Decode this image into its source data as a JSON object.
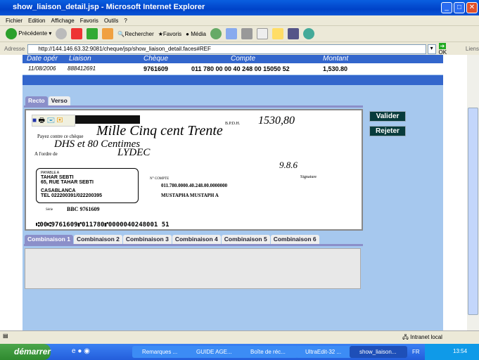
{
  "window": {
    "title": "show_liaison_detail.jsp - Microsoft Internet Explorer"
  },
  "menu": [
    "Fichier",
    "Edition",
    "Affichage",
    "Favoris",
    "Outils",
    "?"
  ],
  "toolbar": {
    "back": "Précédente",
    "search": "Rechercher",
    "favorites": "Favoris",
    "media": "Média"
  },
  "address": {
    "label": "Adresse",
    "url": "http://144.146.63.32:9081/cheque/jsp/show_liaison_detail.faces#REF",
    "go": "OK",
    "links": "Liens"
  },
  "table": {
    "headers": [
      "Date opér",
      "Liaison",
      "Chèque",
      "Compte",
      "Montant"
    ],
    "row": [
      "11/08/2006",
      "888412691",
      "9761609",
      "011 780 00 00 40 248 00 15050 52",
      "1,530.80"
    ]
  },
  "image_tabs": [
    "Recto",
    "Verso"
  ],
  "check": {
    "amount_label": "B.P.D.H.",
    "amount": "1530,80",
    "pay_label": "Payez contre ce chèque",
    "order_label": "A l'ordre de",
    "words1": "Mille Cinq cent Trente",
    "words2": "DHS et 80 Centimes",
    "payee": "LYDEC",
    "place_date": "9.8.6",
    "payable_label": "PAYABLE A",
    "bank_name": "TAHAR SEBTI",
    "bank_addr": "65, RUE TAHAR SEBTI",
    "city": "CASABLANCA",
    "tel": "TEL 022200391/022200395",
    "account_label": "N° COMPTE",
    "account": "011.780.0000.40.248.00.0000000",
    "holder": "MUSTAPHA MUSTAPH A",
    "serie_label": "Série",
    "serie": "BBC 9761609",
    "micr": "⑆00⑆9761609⑈011780⑈0000040248001 51",
    "signature_label": "Signature"
  },
  "actions": {
    "validate": "Valider",
    "reject": "Rejeter"
  },
  "combo_tabs": [
    "Combinaison 1",
    "Combinaison 2",
    "Combinaison 3",
    "Combinaison 4",
    "Combinaison 5",
    "Combinaison 6"
  ],
  "status": {
    "zone": "Intranet local"
  },
  "taskbar": {
    "start": "démarrer",
    "items": [
      "Remarques ...",
      "GUIDE AGE...",
      "Boîte de réc...",
      "UltraEdit-32 ...",
      "show_liaison..."
    ],
    "lang": "FR",
    "clock": "13:54"
  }
}
